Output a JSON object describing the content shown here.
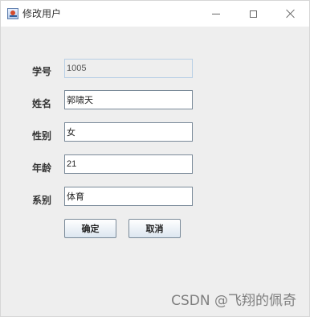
{
  "window": {
    "title": "修改用户"
  },
  "form": {
    "student_id_label": "学号",
    "student_id_value": "1005",
    "name_label": "姓名",
    "name_value": "郭啸天",
    "gender_label": "性别",
    "gender_value": "女",
    "age_label": "年龄",
    "age_value": "21",
    "department_label": "系别",
    "department_value": "体育"
  },
  "buttons": {
    "confirm": "确定",
    "cancel": "取消"
  },
  "watermark": "CSDN @飞翔的佩奇",
  "icons": {
    "app": "java-cup-icon",
    "minimize": "minimize-icon",
    "maximize": "maximize-icon",
    "close": "close-icon"
  },
  "colors": {
    "window_background": "#eeeeee",
    "titlebar_background": "#ffffff",
    "readonly_border": "#b8cfe5",
    "field_border": "#7a8a99"
  }
}
